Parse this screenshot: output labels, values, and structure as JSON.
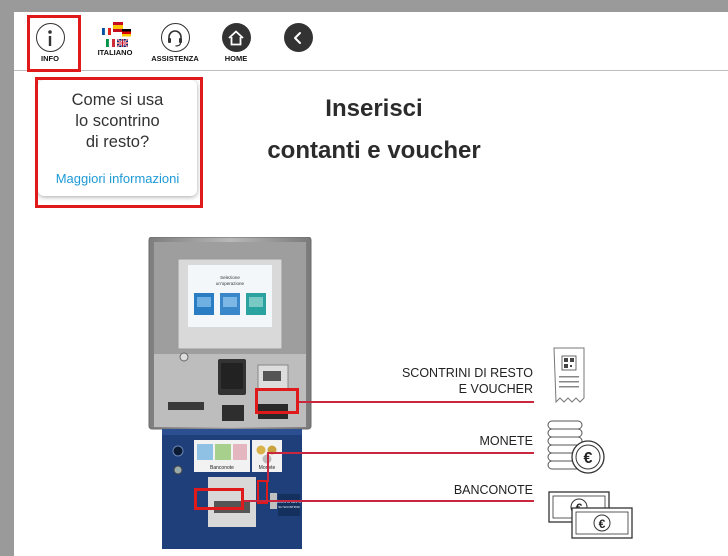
{
  "toolbar": {
    "info_label": "INFO",
    "language_label": "ITALIANO",
    "assistance_label": "ASSISTENZA",
    "home_label": "HOME"
  },
  "popup": {
    "question_line1": "Come si usa",
    "question_line2": "lo scontrino",
    "question_line3": "di resto?",
    "link": "Maggiori informazioni"
  },
  "main": {
    "title_line1": "Inserisci",
    "title_line2": "contanti e voucher"
  },
  "machine": {
    "screen_title": "Selezione",
    "screen_subtitle": "un'operazione",
    "panel_left": "Banconote",
    "panel_right": "Monete",
    "sticker": "BUONI DI RESTO\nSTAMPATI SU SCONTRINI"
  },
  "labels": {
    "receipts_line1": "SCONTRINI DI RESTO",
    "receipts_line2": "E VOUCHER",
    "coins": "MONETE",
    "banknotes": "BANCONOTE"
  },
  "colors": {
    "highlight": "#e0191b",
    "link": "#1e9ad6",
    "callout_line": "#c9263f",
    "machine_panel": "#1f3f7a"
  },
  "icons": [
    "info-icon",
    "flags-icon",
    "headset-icon",
    "home-icon",
    "back-icon",
    "receipt-icon",
    "coins-euro-icon",
    "banknotes-euro-icon"
  ]
}
